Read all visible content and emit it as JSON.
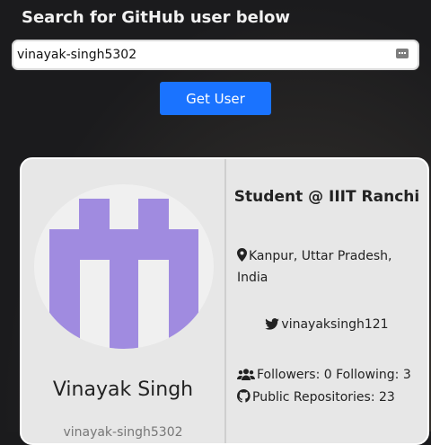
{
  "header": {
    "title": "Search for GitHub user below"
  },
  "search": {
    "value": "vinayak-singh5302"
  },
  "actions": {
    "get_user_label": "Get User"
  },
  "profile": {
    "name": "Vinayak Singh",
    "login": "vinayak-singh5302",
    "bio": "Student @ IIIT Ranchi",
    "location": "Kanpur, Uttar Pradesh, India",
    "twitter": "vinayaksingh121",
    "followers_label": "Followers: 0",
    "following_label": "Following: 3",
    "repos_label": "Public Repositories: 23"
  },
  "colors": {
    "accent": "#1a73ff",
    "avatar": "#a08be0",
    "card": "#e7e7e7"
  },
  "icons": [
    "keys-icon",
    "location-pin-icon",
    "twitter-icon",
    "users-icon",
    "github-icon"
  ]
}
